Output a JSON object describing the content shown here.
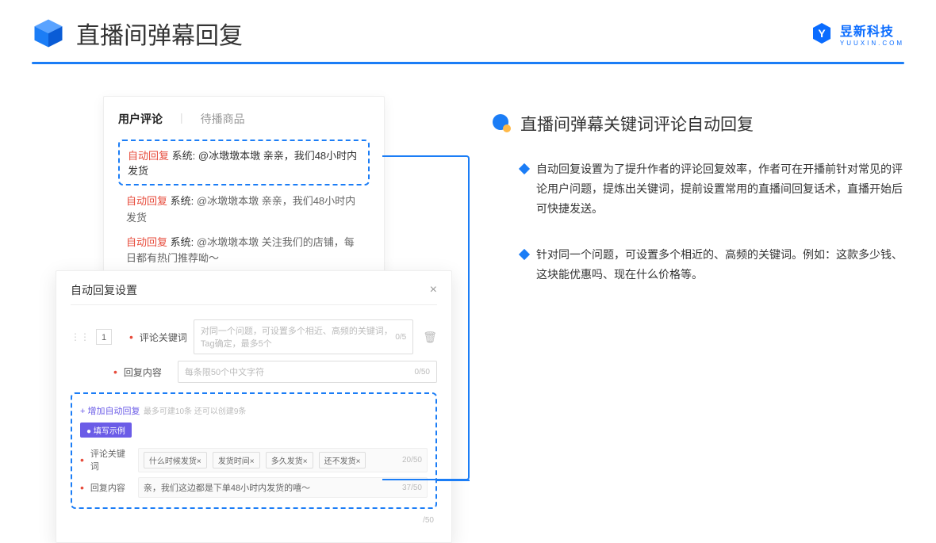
{
  "header": {
    "title": "直播间弹幕回复",
    "brand_name": "昱新科技",
    "brand_sub": "YUUXIN.COM"
  },
  "card1": {
    "tab_active": "用户评论",
    "tab_inactive": "待播商品",
    "msg1_tag": "自动回复",
    "msg1_sys": "系统:",
    "msg1_text": "@冰墩墩本墩 亲亲，我们48小时内发货",
    "msg2_tag": "自动回复",
    "msg2_sys": "系统:",
    "msg2_text": "@冰墩墩本墩 亲亲，我们48小时内发货",
    "msg3_tag": "自动回复",
    "msg3_sys": "系统:",
    "msg3_text": "@冰墩墩本墩 关注我们的店铺，每日都有热门推荐呦～"
  },
  "card2": {
    "title": "自动回复设置",
    "row_num": "1",
    "kw_label": "评论关键词",
    "kw_placeholder": "对同一个问题，可设置多个相近、高频的关键词，Tag确定，最多5个",
    "kw_count": "0/5",
    "content_label": "回复内容",
    "content_placeholder": "每条限50个中文字符",
    "content_count": "0/50",
    "add_link": "+ 增加自动回复",
    "add_hint": "最多可建10条 还可以创建9条",
    "badge": "● 填写示例",
    "ex_kw_label": "评论关键词",
    "ex_tag1": "什么时候发货×",
    "ex_tag2": "发货时间×",
    "ex_tag3": "多久发货×",
    "ex_tag4": "还不发货×",
    "ex_kw_count": "20/50",
    "ex_content_label": "回复内容",
    "ex_content_text": "亲，我们这边都是下单48小时内发货的嘻～",
    "ex_content_count": "37/50",
    "tail_count": "/50"
  },
  "right": {
    "section_title": "直播间弹幕关键词评论自动回复",
    "bullet1": "自动回复设置为了提升作者的评论回复效率，作者可在开播前针对常见的评论用户问题，提炼出关键词，提前设置常用的直播间回复话术，直播开始后可快捷发送。",
    "bullet2": "针对同一个问题，可设置多个相近的、高频的关键词。例如：这款多少钱、这块能优惠吗、现在什么价格等。"
  }
}
